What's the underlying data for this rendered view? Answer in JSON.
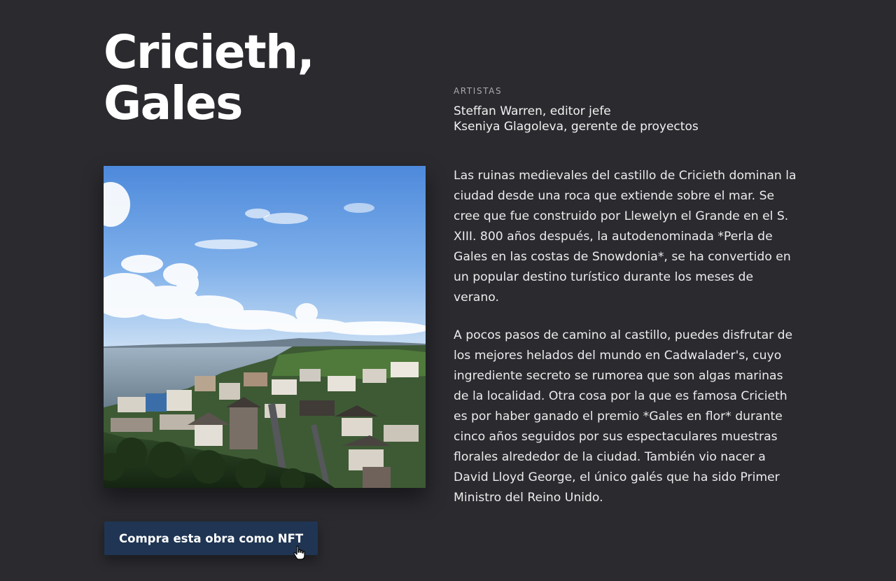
{
  "title": "Cricieth, Gales",
  "artists": {
    "label": "ARTISTAS",
    "names": [
      "Steffan Warren, editor jefe",
      "Kseniya Glagoleva, gerente de proyectos"
    ]
  },
  "image": {
    "icon": "photo-cricieth-coastal-town"
  },
  "body": {
    "paragraphs": [
      "Las ruinas medievales del castillo de Cricieth dominan la ciudad desde una roca que extiende sobre el mar. Se cree que fue construido por Llewelyn el Grande en el S. XIII. 800 años después, la autodenominada *Perla de Gales en las costas de Snowdonia*, se ha convertido en un popular destino turístico durante los meses de verano.",
      "A pocos pasos de camino al castillo, puedes disfrutar de los mejores helados del mundo en Cadwalader's, cuyo ingrediente secreto se rumorea que son algas marinas de la localidad. Otra cosa por la que es famosa Cricieth es por haber ganado el premio *Gales en flor* durante cinco años seguidos por sus espectaculares muestras florales alrededor de la ciudad. También vio nacer a David Lloyd George, el único galés que ha sido Primer Ministro del Reino Unido."
    ]
  },
  "cta": {
    "label": "Compra esta obra como NFT"
  },
  "cursor": {
    "icon": "hand-pointer-icon"
  },
  "colors": {
    "background": "#2a2a2f",
    "button": "#1f3553",
    "text": "#f2f2f2"
  }
}
